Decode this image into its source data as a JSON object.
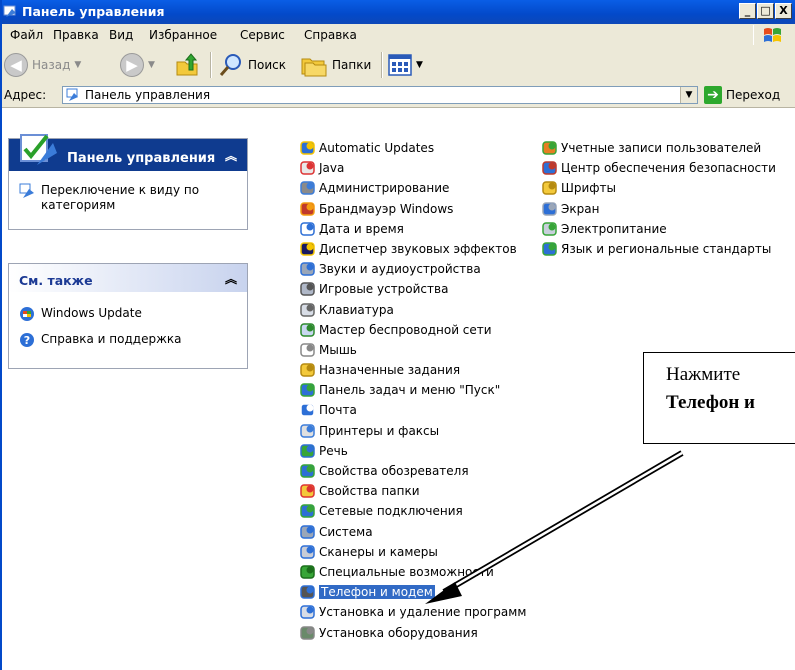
{
  "window": {
    "title": "Панель управления",
    "controls": [
      "_",
      "□",
      "X"
    ]
  },
  "menu": [
    "Файл",
    "Правка",
    "Вид",
    "Избранное",
    "Сервис",
    "Справка"
  ],
  "toolbar": {
    "back_label": "Назад",
    "search_label": "Поиск",
    "folders_label": "Папки"
  },
  "address": {
    "label": "Адрес:",
    "value": "Панель управления",
    "go_label": "Переход"
  },
  "left_pane": {
    "control_panel": {
      "title": "Панель управления",
      "task": "Переключение к виду по категориям"
    },
    "see_also": {
      "title": "См. также",
      "items": [
        "Windows Update",
        "Справка и поддержка"
      ]
    }
  },
  "items_col1": [
    {
      "label": "Automatic Updates",
      "icon": "windows-update-icon"
    },
    {
      "label": "Java",
      "icon": "java-icon"
    },
    {
      "label": "Администрирование",
      "icon": "admin-tools-icon"
    },
    {
      "label": "Брандмауэр Windows",
      "icon": "firewall-icon"
    },
    {
      "label": "Дата и время",
      "icon": "clock-icon"
    },
    {
      "label": "Диспетчер звуковых эффектов",
      "icon": "sound-effects-icon"
    },
    {
      "label": "Звуки и аудиоустройства",
      "icon": "speaker-icon"
    },
    {
      "label": "Игровые устройства",
      "icon": "gamepad-icon"
    },
    {
      "label": "Клавиатура",
      "icon": "keyboard-icon"
    },
    {
      "label": "Мастер беспроводной сети",
      "icon": "wireless-icon"
    },
    {
      "label": "Мышь",
      "icon": "mouse-icon"
    },
    {
      "label": "Назначенные задания",
      "icon": "scheduled-tasks-icon"
    },
    {
      "label": "Панель задач и меню \"Пуск\"",
      "icon": "taskbar-icon"
    },
    {
      "label": "Почта",
      "icon": "mail-icon"
    },
    {
      "label": "Принтеры и факсы",
      "icon": "printer-icon"
    },
    {
      "label": "Речь",
      "icon": "speech-icon"
    },
    {
      "label": "Свойства обозревателя",
      "icon": "internet-options-icon"
    },
    {
      "label": "Свойства папки",
      "icon": "folder-options-icon"
    },
    {
      "label": "Сетевые подключения",
      "icon": "network-icon"
    },
    {
      "label": "Система",
      "icon": "system-icon"
    },
    {
      "label": "Сканеры и камеры",
      "icon": "scanner-icon"
    },
    {
      "label": "Специальные возможности",
      "icon": "accessibility-icon"
    },
    {
      "label": "Телефон и модем",
      "icon": "phone-modem-icon"
    },
    {
      "label": "Установка и удаление программ",
      "icon": "add-remove-icon"
    },
    {
      "label": "Установка оборудования",
      "icon": "hardware-icon"
    }
  ],
  "items_col2": [
    {
      "label": "Учетные записи пользователей",
      "icon": "users-icon"
    },
    {
      "label": "Центр обеспечения безопасности",
      "icon": "security-center-icon"
    },
    {
      "label": "Шрифты",
      "icon": "fonts-folder-icon"
    },
    {
      "label": "Экран",
      "icon": "display-icon"
    },
    {
      "label": "Электропитание",
      "icon": "power-icon"
    },
    {
      "label": "Язык и региональные стандарты",
      "icon": "globe-icon"
    }
  ],
  "selected_item": "Телефон и модем",
  "callout": {
    "line1": "Нажмите",
    "line2": "Телефон и"
  }
}
